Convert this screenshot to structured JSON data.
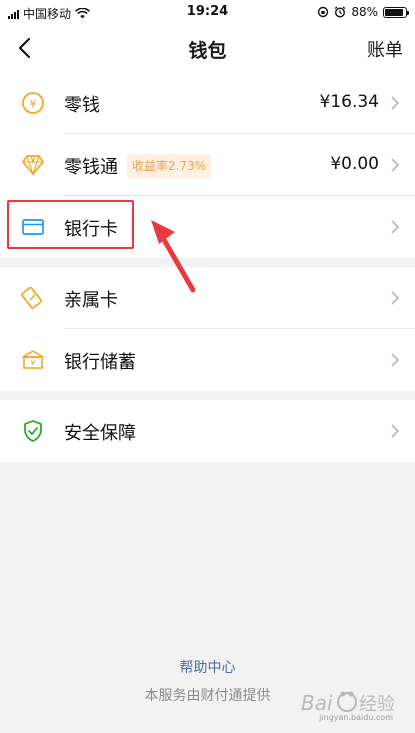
{
  "status_bar": {
    "carrier": "中国移动",
    "time": "19:24",
    "battery_text": "88%",
    "battery_level": 0.88,
    "wifi_icon": "wifi-icon",
    "alarm_icon": "alarm-icon",
    "rotation_lock_icon": "rotation-lock-icon"
  },
  "header": {
    "title": "钱包",
    "back_icon": "chevron-left-icon",
    "bill_label": "账单"
  },
  "groups": [
    {
      "items": [
        {
          "label": "零钱",
          "value": "¥16.34",
          "icon": "yuan-coin-icon"
        },
        {
          "label": "零钱通",
          "badge": "收益率2.73%",
          "value": "¥0.00",
          "icon": "diamond-icon"
        },
        {
          "label": "银行卡",
          "icon": "bank-card-icon"
        }
      ]
    },
    {
      "items": [
        {
          "label": "亲属卡",
          "icon": "family-card-icon"
        },
        {
          "label": "银行储蓄",
          "icon": "bank-savings-icon"
        }
      ]
    },
    {
      "items": [
        {
          "label": "安全保障",
          "icon": "security-shield-icon"
        }
      ]
    }
  ],
  "footer": {
    "help_link": "帮助中心",
    "note": "本服务由财付通提供"
  },
  "watermark": {
    "text": "jingyan.baidu.com",
    "logo_text": "Bai经验"
  },
  "colors": {
    "accent_orange": "#f5a623",
    "security_green": "#1aad19",
    "card_blue": "#2196f3",
    "annotation_red": "#e8393d",
    "link_blue": "#4c6c9a"
  }
}
